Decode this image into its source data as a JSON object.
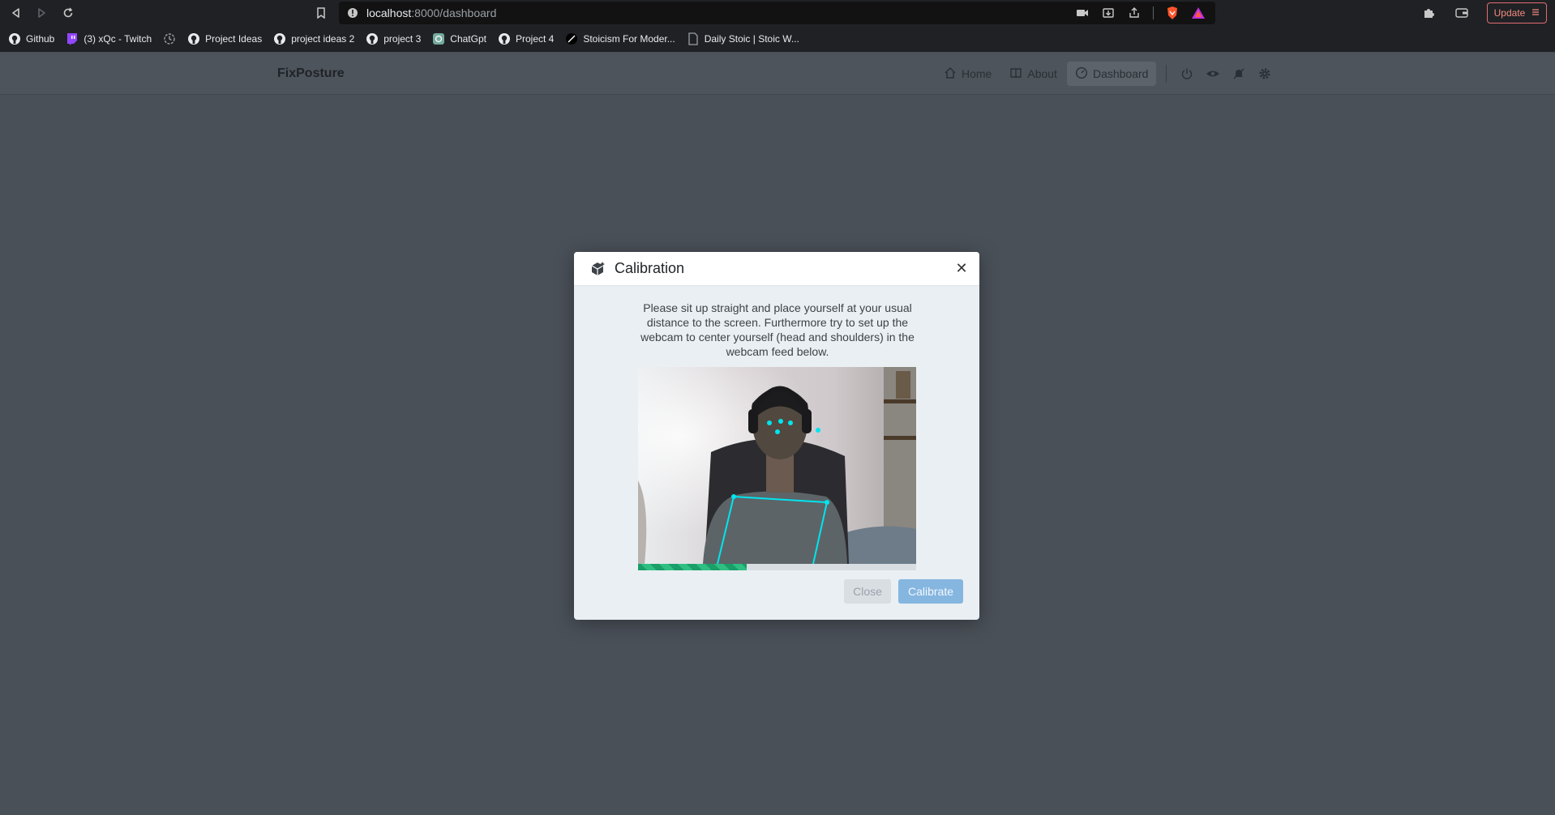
{
  "browser": {
    "url_host": "localhost",
    "url_path": ":8000/dashboard",
    "update_label": "Update",
    "bookmarks": [
      {
        "label": "Github",
        "icon": "github-icon"
      },
      {
        "label": "(3) xQc - Twitch",
        "icon": "twitch-icon"
      },
      {
        "label": "",
        "icon": "history-icon"
      },
      {
        "label": "Project Ideas",
        "icon": "github-icon"
      },
      {
        "label": "project ideas 2",
        "icon": "github-icon"
      },
      {
        "label": "project 3",
        "icon": "github-icon"
      },
      {
        "label": "ChatGpt",
        "icon": "chatgpt-icon"
      },
      {
        "label": "Project 4",
        "icon": "github-icon"
      },
      {
        "label": "Stoicism For Moder...",
        "icon": "stoic-icon"
      },
      {
        "label": "Daily Stoic | Stoic W...",
        "icon": "page-icon"
      }
    ]
  },
  "app": {
    "brand": "FixPosture",
    "nav": [
      {
        "label": "Home",
        "icon": "home-icon"
      },
      {
        "label": "About",
        "icon": "book-icon"
      },
      {
        "label": "Dashboard",
        "icon": "dashboard-icon",
        "active": true
      }
    ],
    "nav_icons": [
      "power-icon",
      "eye-icon",
      "bell-off-icon",
      "gear-icon"
    ]
  },
  "modal": {
    "title": "Calibration",
    "text": "Please sit up straight and place yourself at your usual distance to the screen. Furthermore try to set up the webcam to center yourself (head and shoulders) in the webcam feed below.",
    "progress": 0.39,
    "close_label": "Close",
    "calibrate_label": "Calibrate",
    "colors": {
      "accent": "#85b6e0",
      "progress": "#1a9e6a",
      "pose": "#00e5ee"
    }
  }
}
